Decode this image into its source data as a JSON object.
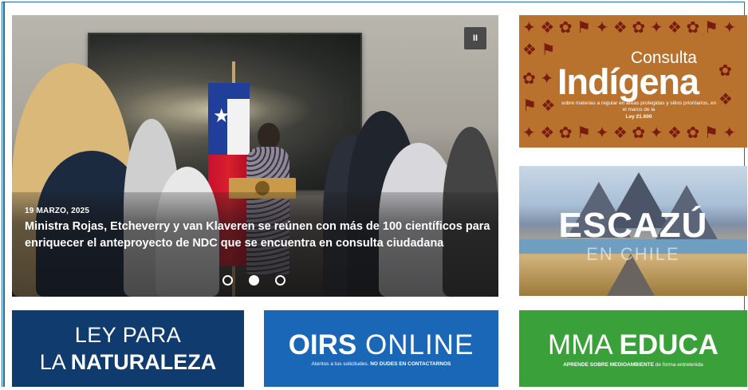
{
  "slider": {
    "date": "19 MARZO, 2025",
    "title": "Ministra Rojas, Etcheverry y van Klaveren se reúnen con más de 100 científicos para enriquecer el anteproyecto de NDC que se encuentra en consulta ciudadana",
    "pause_label": "II",
    "slide_count": 3,
    "active_slide": 2
  },
  "banners": {
    "consulta": {
      "line1": "Consulta",
      "line2": "Indígena",
      "line3": "sobre materias a regular en áreas protegidas y sitios prioritarios, en el marco de la",
      "line4": "Ley 21.600"
    },
    "escazu": {
      "line1": "ESCAZÚ",
      "line2": "EN CHILE"
    },
    "ley": {
      "line1": "LEY PARA",
      "line2_a": "LA ",
      "line2_b": "NATURALEZA"
    },
    "oirs": {
      "title_a": "OIRS",
      "title_b": " ONLINE",
      "sub_a": "Atentos a tus solicitudes. ",
      "sub_b": "NO DUDES EN CONTACTARNOS"
    },
    "mma": {
      "title_a": "MMA ",
      "title_b": "EDUCA",
      "sub_a": "APRENDE SOBRE MEDIOAMBIENTE",
      "sub_b": " de forma entretenida"
    }
  },
  "colors": {
    "frame": "#1f6fa3",
    "ley_bg": "#0f3b6e",
    "oirs_bg": "#1a67b7",
    "mma_bg": "#3aa03a",
    "consulta_bg": "#b8722e"
  }
}
